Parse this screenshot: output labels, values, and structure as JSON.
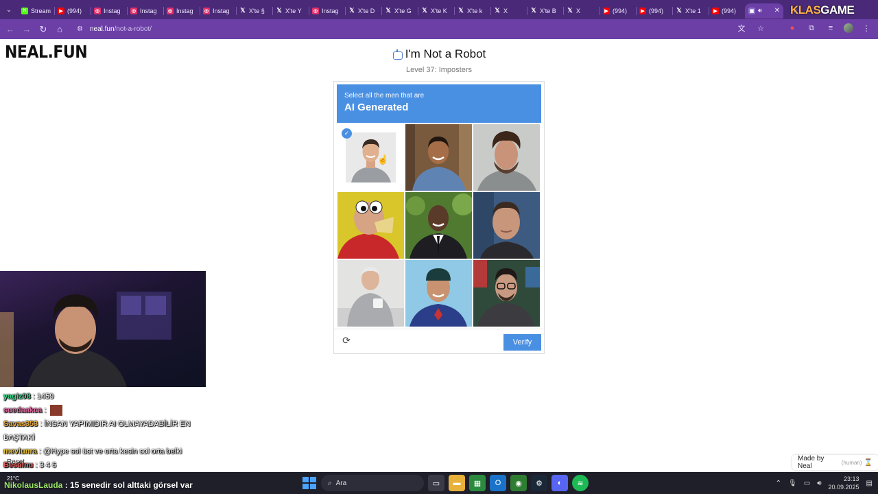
{
  "browser": {
    "tabs": [
      {
        "label": "Stream",
        "icon": "k-icon",
        "color": "#53fc18"
      },
      {
        "label": "(994)",
        "icon": "youtube-icon",
        "color": "#ff0000"
      },
      {
        "label": "Instag",
        "icon": "instagram-icon",
        "color": "#e1306c"
      },
      {
        "label": "Instag",
        "icon": "instagram-icon",
        "color": "#e1306c"
      },
      {
        "label": "Instag",
        "icon": "instagram-icon",
        "color": "#e1306c"
      },
      {
        "label": "Instag",
        "icon": "instagram-icon",
        "color": "#e1306c"
      },
      {
        "label": "X'te §",
        "icon": "x-icon",
        "color": "#000000"
      },
      {
        "label": "X'te Y",
        "icon": "x-icon",
        "color": "#000000"
      },
      {
        "label": "Instag",
        "icon": "instagram-icon",
        "color": "#e1306c"
      },
      {
        "label": "X'te D",
        "icon": "x-icon",
        "color": "#000000"
      },
      {
        "label": "X'te G",
        "icon": "x-icon",
        "color": "#000000"
      },
      {
        "label": "X'te K",
        "icon": "x-icon",
        "color": "#000000"
      },
      {
        "label": "X'te k",
        "icon": "x-icon",
        "color": "#000000"
      },
      {
        "label": "X",
        "icon": "x-icon",
        "color": "#000000"
      },
      {
        "label": "X'te B",
        "icon": "x-icon",
        "color": "#000000"
      },
      {
        "label": "X",
        "icon": "x-icon",
        "color": "#000000"
      },
      {
        "label": "(994)",
        "icon": "youtube-icon",
        "color": "#ff0000"
      },
      {
        "label": "(994)",
        "icon": "youtube-icon",
        "color": "#ff0000"
      },
      {
        "label": "X'te 1",
        "icon": "x-icon",
        "color": "#000000"
      },
      {
        "label": "(994)",
        "icon": "youtube-icon",
        "color": "#ff0000"
      }
    ],
    "active_tab_close": "✕",
    "new_tab": "+",
    "brand_a": "KLAS",
    "brand_b": "GAME",
    "url_host": "neal.fun",
    "url_path": "/not-a-robot/"
  },
  "page": {
    "logo": "NEAL.FUN",
    "title": "I'm Not a Robot",
    "subtitle": "Level 37: Imposters"
  },
  "captcha": {
    "instruction": "Select all the men that are",
    "target": "AI Generated",
    "accent": "#4a90e2",
    "tiles": [
      {
        "id": 1,
        "selected": true
      },
      {
        "id": 2,
        "selected": false
      },
      {
        "id": 3,
        "selected": false
      },
      {
        "id": 4,
        "selected": false
      },
      {
        "id": 5,
        "selected": false
      },
      {
        "id": 6,
        "selected": false
      },
      {
        "id": 7,
        "selected": false
      },
      {
        "id": 8,
        "selected": false
      },
      {
        "id": 9,
        "selected": false
      }
    ],
    "verify_label": "Verify"
  },
  "footer": {
    "made_by": "Made by Neal",
    "human": "(human)"
  },
  "stream": {
    "chat": [
      {
        "user": "yagiz08",
        "color": "#39d98a",
        "text": ": 1459"
      },
      {
        "user": "suedaakca",
        "color": "#d86b9e",
        "text": ":"
      },
      {
        "user": "Savas353",
        "color": "#e8a93a",
        "text": ": İNSAN YAPIMIDIR AI OLMAYADABİLİR EN BAŞTAKİ"
      },
      {
        "user": "mevlunra",
        "color": "#e8c23a",
        "text": ": @Hype sol üst ve orta kesin sol orta belki"
      },
      {
        "user": "Bestimu",
        "color": "#e85a5a",
        "text": ": 3 4 6"
      }
    ],
    "reset_label": "Reset",
    "last_user": "NikolausLauda",
    "last_text": ": 15 senedir sol alttaki görsel var",
    "weather": "21°C"
  },
  "taskbar": {
    "search_placeholder": "Ara",
    "time": "23:13",
    "date": "20.09.2025"
  }
}
